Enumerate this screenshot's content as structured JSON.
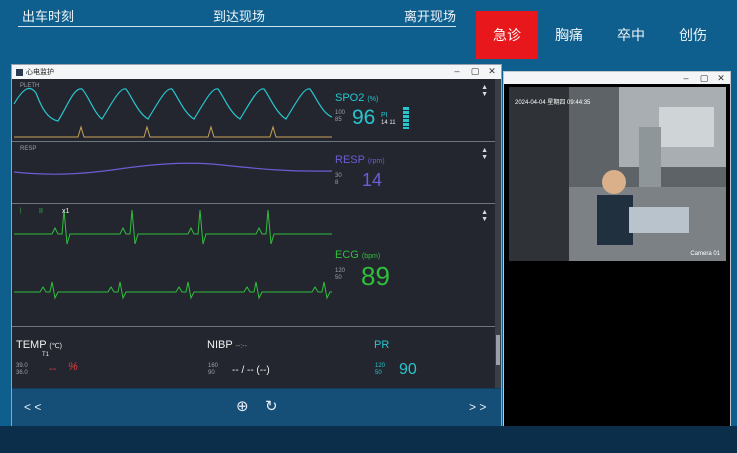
{
  "timeline": {
    "depart": "出车时刻",
    "arrive": "到达现场",
    "leave": "离开现场"
  },
  "tabs": [
    {
      "label": "急诊",
      "active": true
    },
    {
      "label": "胸痛",
      "active": false
    },
    {
      "label": "卒中",
      "active": false
    },
    {
      "label": "创伤",
      "active": false
    }
  ],
  "monitor": {
    "window_title": "心电监护",
    "spo2": {
      "trace_label": "PLETH",
      "title": "SPO2",
      "unit": "(%)",
      "high": "100",
      "low": "85",
      "value": "96",
      "pi_label": "PI",
      "pi_value": "14",
      "pi_extra": "11"
    },
    "resp": {
      "trace_label": "RESP",
      "title": "RESP",
      "unit": "(rpm)",
      "high": "30",
      "low": "8",
      "value": "14"
    },
    "ecg": {
      "lead": "II",
      "gain": "x1",
      "title": "ECG",
      "unit": "(bpm)",
      "high": "120",
      "low": "50",
      "value": "89"
    },
    "temp": {
      "title": "TEMP",
      "unit": "(℃)",
      "channel": "T1",
      "high": "39.0",
      "low": "36.0",
      "value": "--"
    },
    "nibp": {
      "title": "NIBP",
      "time": "--:--",
      "high": "160",
      "low": "90",
      "value": "-- / -- (--)"
    },
    "pr": {
      "title": "PR",
      "high": "120",
      "low": "50",
      "value": "90"
    },
    "toolbar": {
      "prev": "< <",
      "next": "> >"
    }
  },
  "video": {
    "timestamp": "2024-04-04 星期四 09:44:35",
    "camera": "Camera 01"
  },
  "colors": {
    "background": "#0f5f8e",
    "active_tab": "#e8171c",
    "spo2": "#27c6cf",
    "resp": "#6e5cd6",
    "ecg": "#2fbf3c",
    "pr": "#27c6cf",
    "temp_alarm": "#e23b3b"
  }
}
